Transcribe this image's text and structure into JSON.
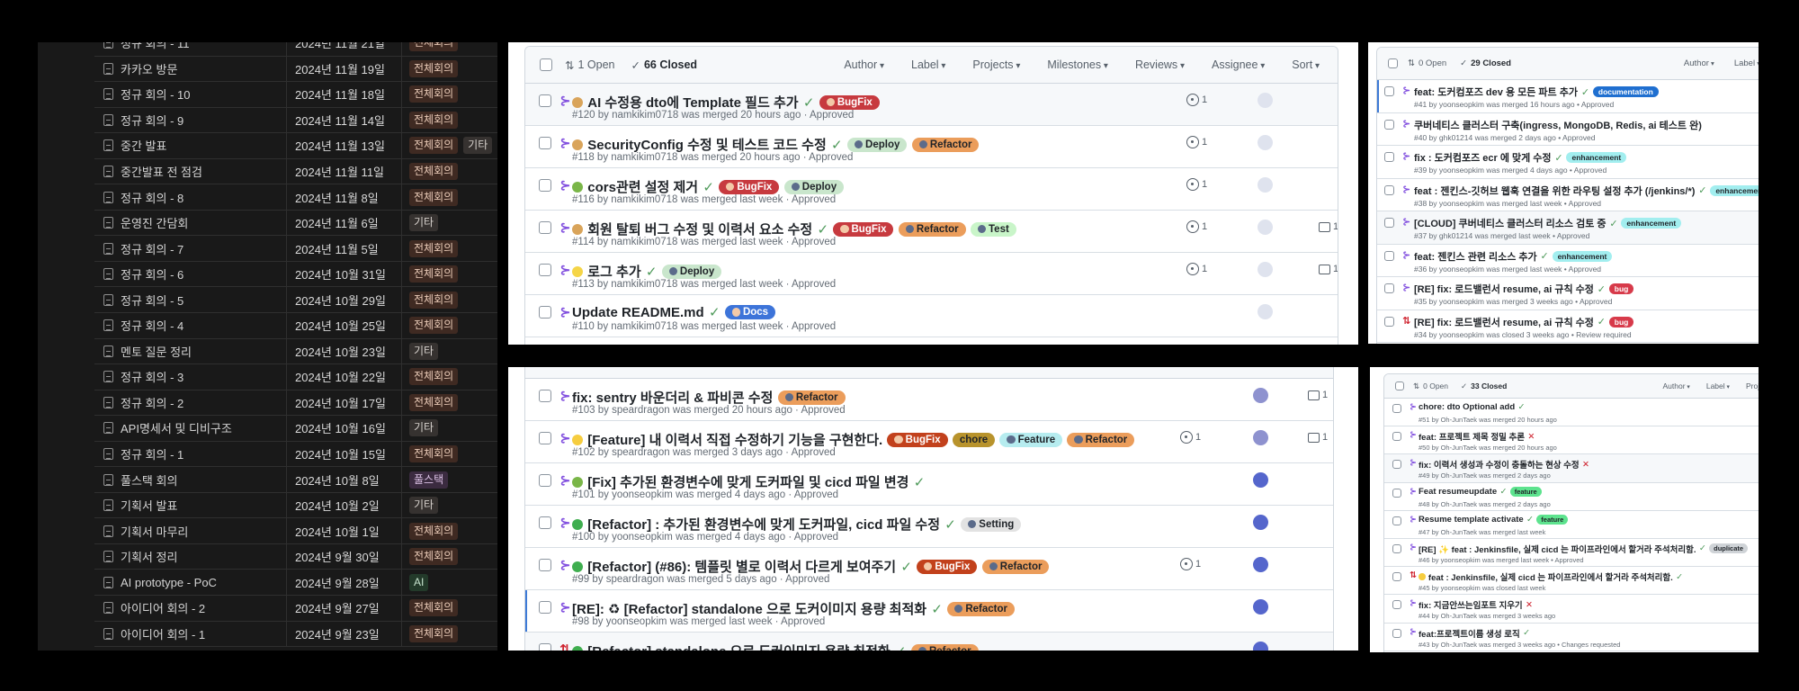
{
  "notion": {
    "tag_colors": {
      "전체회의": {
        "bg": "#3f2a22",
        "fg": "#e8c9b6"
      },
      "기타": {
        "bg": "#363230",
        "fg": "#d6d1cc"
      },
      "풀스택": {
        "bg": "#3b2b40",
        "fg": "#dcc2e6"
      },
      "AI": {
        "bg": "#233a2a",
        "fg": "#c6e3cd"
      }
    },
    "rows": [
      {
        "name": "정규 회의 - 11",
        "date": "2024년 11월 21일",
        "tags": [
          "전체회의"
        ]
      },
      {
        "name": "카카오 방문",
        "date": "2024년 11월 19일",
        "tags": [
          "전체회의"
        ]
      },
      {
        "name": "정규 회의 - 10",
        "date": "2024년 11월 18일",
        "tags": [
          "전체회의"
        ]
      },
      {
        "name": "정규 회의 - 9",
        "date": "2024년 11월 14일",
        "tags": [
          "전체회의"
        ]
      },
      {
        "name": "중간 발표",
        "date": "2024년 11월 13일",
        "tags": [
          "전체회의",
          "기타"
        ]
      },
      {
        "name": "중간발표 전 점검",
        "date": "2024년 11월 11일",
        "tags": [
          "전체회의"
        ]
      },
      {
        "name": "정규 회의 - 8",
        "date": "2024년 11월 8일",
        "tags": [
          "전체회의"
        ]
      },
      {
        "name": "운영진 간담회",
        "date": "2024년 11월 6일",
        "tags": [
          "기타"
        ]
      },
      {
        "name": "정규 회의 - 7",
        "date": "2024년 11월 5일",
        "tags": [
          "전체회의"
        ]
      },
      {
        "name": "정규 회의 - 6",
        "date": "2024년 10월 31일",
        "tags": [
          "전체회의"
        ]
      },
      {
        "name": "정규 회의 - 5",
        "date": "2024년 10월 29일",
        "tags": [
          "전체회의"
        ]
      },
      {
        "name": "정규 회의 - 4",
        "date": "2024년 10월 25일",
        "tags": [
          "전체회의"
        ]
      },
      {
        "name": "멘토 질문 정리",
        "date": "2024년 10월 23일",
        "tags": [
          "기타"
        ]
      },
      {
        "name": "정규 회의 - 3",
        "date": "2024년 10월 22일",
        "tags": [
          "전체회의"
        ]
      },
      {
        "name": "정규 회의 - 2",
        "date": "2024년 10월 17일",
        "tags": [
          "전체회의"
        ]
      },
      {
        "name": "API명세서 및 디비구조",
        "date": "2024년 10월 16일",
        "tags": [
          "기타"
        ]
      },
      {
        "name": "정규 회의 - 1",
        "date": "2024년 10월 15일",
        "tags": [
          "전체회의"
        ]
      },
      {
        "name": "풀스택 회의",
        "date": "2024년 10월 8일",
        "tags": [
          "풀스택"
        ]
      },
      {
        "name": "기획서 발표",
        "date": "2024년 10월 2일",
        "tags": [
          "기타"
        ]
      },
      {
        "name": "기획서 마무리",
        "date": "2024년 10월 1일",
        "tags": [
          "전체회의"
        ]
      },
      {
        "name": "기획서 정리",
        "date": "2024년 9월 30일",
        "tags": [
          "전체회의"
        ]
      },
      {
        "name": "AI prototype - PoC",
        "date": "2024년 9월 28일",
        "tags": [
          "AI"
        ]
      },
      {
        "name": "아이디어 회의 - 2",
        "date": "2024년 9월 27일",
        "tags": [
          "전체회의"
        ]
      },
      {
        "name": "아이디어 회의 - 1",
        "date": "2024년 9월 23일",
        "tags": [
          "전체회의"
        ]
      }
    ]
  },
  "labels": {
    "BugFix": {
      "text": "BugFix",
      "bg": "#c73a3f",
      "fg": "#ffffff",
      "icon": "bug"
    },
    "BugFix2": {
      "text": "BugFix",
      "bg": "#c2411c",
      "fg": "#ffffff",
      "icon": "bug"
    },
    "Deploy": {
      "text": "Deploy",
      "bg": "#c9e6cc",
      "fg": "#1f2328",
      "icon": "globe"
    },
    "Refactor": {
      "text": "Refactor",
      "bg": "#eb9d5b",
      "fg": "#1f2328",
      "icon": "hammer"
    },
    "Test": {
      "text": "Test",
      "bg": "#c9f5c9",
      "fg": "#1f2328",
      "icon": "check-box"
    },
    "Docs": {
      "text": "Docs",
      "bg": "#3d74d9",
      "fg": "#ffffff",
      "icon": "book"
    },
    "chore": {
      "text": "chore",
      "bg": "#b8932c",
      "fg": "#1f2328",
      "icon": ""
    },
    "Feature": {
      "text": "Feature",
      "bg": "#b6ecef",
      "fg": "#1f2328",
      "icon": "sparkles"
    },
    "Setting": {
      "text": "Setting",
      "bg": "#e2e2e2",
      "fg": "#1f2328",
      "icon": "gear"
    },
    "documentation": {
      "text": "documentation",
      "bg": "#1f6fd0",
      "fg": "#ffffff",
      "icon": ""
    },
    "enhancement": {
      "text": "enhancement",
      "bg": "#a2eeef",
      "fg": "#1f2328",
      "icon": ""
    },
    "bug": {
      "text": "bug",
      "bg": "#d73a4a",
      "fg": "#ffffff",
      "icon": ""
    },
    "feature": {
      "text": "feature",
      "bg": "#5de38e",
      "fg": "#1f2328",
      "icon": ""
    },
    "duplicate": {
      "text": "duplicate",
      "bg": "#cfd3d7",
      "fg": "#1f2328",
      "icon": ""
    }
  },
  "emoji_colors": {
    "palette": "#d9a45a",
    "caterpillar": "#7ab648",
    "bulb": "#f5d547",
    "sparkles": "#f6cd3f",
    "recycle": "#3fae4f"
  },
  "colors": {
    "merged": "#8250df",
    "closed": "#cf222e"
  },
  "repo_a": {
    "header": {
      "open": "1 Open",
      "closed": "66 Closed",
      "filters": [
        "Author",
        "Label",
        "Projects",
        "Milestones",
        "Reviews",
        "Assignee",
        "Sort"
      ]
    },
    "prs": [
      {
        "state": "merged",
        "emoji": "palette",
        "title": "AI 수정용 dto에 Template 필드 추가",
        "mark": "check",
        "labels": [
          "BugFix"
        ],
        "meta": "#120 by namkikim0718 was merged 20 hours ago · Approved",
        "reviews": "1",
        "avatar": "#dfe3ee",
        "hl": true
      },
      {
        "state": "merged",
        "emoji": "palette",
        "title": "SecurityConfig 수정 및 테스트 코드 수정",
        "mark": "check",
        "labels": [
          "Deploy",
          "Refactor"
        ],
        "meta": "#118 by namkikim0718 was merged 20 hours ago · Approved",
        "reviews": "1",
        "avatar": "#dfe3ee"
      },
      {
        "state": "merged",
        "emoji": "caterpillar",
        "title": "cors관련 설정 제거",
        "mark": "check",
        "labels": [
          "BugFix",
          "Deploy"
        ],
        "meta": "#116 by namkikim0718 was merged last week · Approved",
        "reviews": "1",
        "avatar": "#dfe3ee"
      },
      {
        "state": "merged",
        "emoji": "palette",
        "title": "회원 탈퇴 버그 수정 및 이력서 요소 수정",
        "mark": "check",
        "labels": [
          "BugFix",
          "Refactor",
          "Test"
        ],
        "meta": "#114 by namkikim0718 was merged last week · Approved",
        "reviews": "1",
        "comments": "1",
        "avatar": "#dfe3ee"
      },
      {
        "state": "merged",
        "emoji": "bulb",
        "title": "로그 추가",
        "mark": "check",
        "labels": [
          "Deploy"
        ],
        "meta": "#113 by namkikim0718 was merged last week · Approved",
        "reviews": "1",
        "comments": "1",
        "avatar": "#dfe3ee"
      },
      {
        "state": "merged",
        "title": "Update README.md",
        "mark": "check",
        "labels": [
          "Docs"
        ],
        "meta": "#110 by namkikim0718 was merged last week · Approved",
        "avatar": "#dfe3ee"
      },
      {
        "state": "merged",
        "title": "",
        "labels": [
          "Docs"
        ],
        "meta": ""
      }
    ]
  },
  "repo_a2": {
    "prs": [
      {
        "state": "merged",
        "title": "fix: sentry 바운더리 & 파비콘 수정",
        "labels": [
          "Refactor"
        ],
        "meta": "#103 by speardragon was merged 20 hours ago · Approved",
        "comments": "1",
        "avatar": "#8e92cf"
      },
      {
        "state": "merged",
        "emoji": "sparkles",
        "title": "[Feature] 내 이력서 직접 수정하기 기능을 구현한다.",
        "labels": [
          "BugFix2",
          "chore",
          "Feature",
          "Refactor"
        ],
        "meta": "#102 by speardragon was merged 3 days ago · Approved",
        "reviews": "1",
        "comments": "1",
        "avatar": "#8e92cf"
      },
      {
        "state": "merged",
        "emoji": "caterpillar",
        "title": "[Fix] 추가된 환경변수에 맞게 도커파일 및 cicd 파일 변경",
        "mark": "check",
        "labels": [],
        "meta": "#101 by yoonseopkim was merged 4 days ago · Approved",
        "avatar": "#5566cc"
      },
      {
        "state": "merged",
        "emoji": "recycle",
        "title": "[Refactor] : 추가된 환경변수에 맞게 도커파일, cicd 파일 수정",
        "mark": "check",
        "labels": [
          "Setting"
        ],
        "meta": "#100 by yoonseopkim was merged 4 days ago · Approved",
        "avatar": "#5566cc"
      },
      {
        "state": "merged",
        "emoji": "recycle",
        "title": "[Refactor] (#86): 템플릿 별로 이력서 다르게 보여주기",
        "mark": "check",
        "labels": [
          "BugFix2",
          "Refactor"
        ],
        "meta": "#99 by speardragon was merged 5 days ago · Approved",
        "reviews": "1",
        "avatar": "#5566cc"
      },
      {
        "state": "merged",
        "title": "[RE]: ♻ [Refactor] standalone 으로 도커이미지 용량 최적화",
        "mark": "check",
        "labels": [
          "Refactor"
        ],
        "meta": "#98 by yoonseopkim was merged last week · Approved",
        "avatar": "#5566cc",
        "focus": true
      },
      {
        "state": "closed",
        "emoji": "recycle",
        "title": "[Refactor] standalone 으로 도커이미지 용량 최적화",
        "mark": "check",
        "labels": [
          "Refactor"
        ],
        "meta": "",
        "avatar": "#5566cc",
        "hl": true
      }
    ]
  },
  "repo_b": {
    "header": {
      "open": "0 Open",
      "closed": "29 Closed",
      "filters": [
        "Author",
        "Label"
      ]
    },
    "prs": [
      {
        "state": "merged",
        "title": "feat: 도커컴포즈 dev 용 모든 파트 추가",
        "mark": "check",
        "labels": [
          "documentation"
        ],
        "meta": "#41 by yoonseopkim was merged 16 hours ago • Approved",
        "focus": true
      },
      {
        "state": "merged",
        "title": "쿠버네티스 클러스터 구축(ingress, MongoDB, Redis, ai 테스트 완)",
        "labels": [],
        "meta": "#40 by ghk01214 was merged 2 days ago • Approved"
      },
      {
        "state": "merged",
        "title": "fix : 도커컴포즈 ecr 에 맞게 수정",
        "mark": "check",
        "labels": [
          "enhancement"
        ],
        "meta": "#39 by yoonseopkim was merged 4 days ago • Approved"
      },
      {
        "state": "merged",
        "title": "feat : 젠킨스-깃허브 웹훅 연결을 위한 라우팅 설정 추가 (/jenkins/*)",
        "mark": "check",
        "labels": [
          "enhancement"
        ],
        "meta": "#38 by yoonseopkim was merged last week • Approved"
      },
      {
        "state": "merged",
        "title": "[CLOUD] 쿠버네티스 클러스터 리소스 검토 중",
        "mark": "check",
        "labels": [
          "enhancement"
        ],
        "meta": "#37 by ghk01214 was merged last week • Approved",
        "hl": true
      },
      {
        "state": "merged",
        "title": "feat: 젠킨스 관련 리소스 추가",
        "mark": "check",
        "labels": [
          "enhancement"
        ],
        "meta": "#36 by yoonseopkim was merged last week • Approved"
      },
      {
        "state": "merged",
        "title": "[RE] fix: 로드밸런서 resume, ai 규칙 수정",
        "mark": "check",
        "labels": [
          "bug"
        ],
        "meta": "#35 by yoonseopkim was merged 3 weeks ago • Approved"
      },
      {
        "state": "closed",
        "title": "[RE] fix: 로드밸런서 resume, ai 규칙 수정",
        "mark": "check",
        "labels": [
          "bug"
        ],
        "meta": "#34 by yoonseopkim was closed 3 weeks ago • Review required"
      },
      {
        "state": "closed",
        "title": "",
        "labels": [],
        "meta": ""
      }
    ]
  },
  "repo_c": {
    "header": {
      "open": "0 Open",
      "closed": "33 Closed",
      "filters": [
        "Author",
        "Label",
        "Projects"
      ]
    },
    "prs": [
      {
        "state": "merged",
        "title": "chore: dto Optional add",
        "mark": "check",
        "labels": [],
        "meta": "#51 by Oh-JunTaek was merged 20 hours ago"
      },
      {
        "state": "merged",
        "title": "feat: 프로젝트 제목 정밀 추론",
        "mark": "cross",
        "labels": [],
        "meta": "#50 by Oh-JunTaek was merged 20 hours ago"
      },
      {
        "state": "merged",
        "title": "fix: 이력서 생성과 수정이 충돌하는 현상 수정",
        "mark": "cross",
        "labels": [],
        "meta": "#49 by Oh-JunTaek was merged 2 days ago",
        "hl": true
      },
      {
        "state": "merged",
        "title": "Feat resumeupdate",
        "mark": "check",
        "labels": [
          "feature"
        ],
        "meta": "#48 by Oh-JunTaek was merged 2 days ago"
      },
      {
        "state": "merged",
        "title": "Resume template activate",
        "mark": "check",
        "labels": [
          "feature"
        ],
        "meta": "#47 by Oh-JunTaek was merged last week"
      },
      {
        "state": "merged",
        "title": "[RE] ✨ feat : Jenkinsfile, 실제 cicd 는 파이프라인에서 할거라 주석처리함.",
        "mark": "check",
        "labels": [
          "duplicate"
        ],
        "meta": "#46 by yoonseopkim was merged last week • Approved"
      },
      {
        "state": "closed",
        "emoji": "sparkles",
        "title": "feat : Jenkinsfile, 실제 cicd 는 파이프라인에서 할거라 주석처리함.",
        "mark": "check",
        "labels": [],
        "meta": "#45 by yoonseopkim was closed last week"
      },
      {
        "state": "merged",
        "title": "fix: 지금안쓰는임포트 지우기",
        "mark": "cross",
        "labels": [],
        "meta": "#44 by Oh-JunTaek was merged 3 weeks ago"
      },
      {
        "state": "merged",
        "title": "feat:프로젝트이름 생성 로직",
        "mark": "check",
        "labels": [],
        "meta": "#43 by Oh-JunTaek was merged 3 weeks ago • Changes requested"
      }
    ]
  }
}
